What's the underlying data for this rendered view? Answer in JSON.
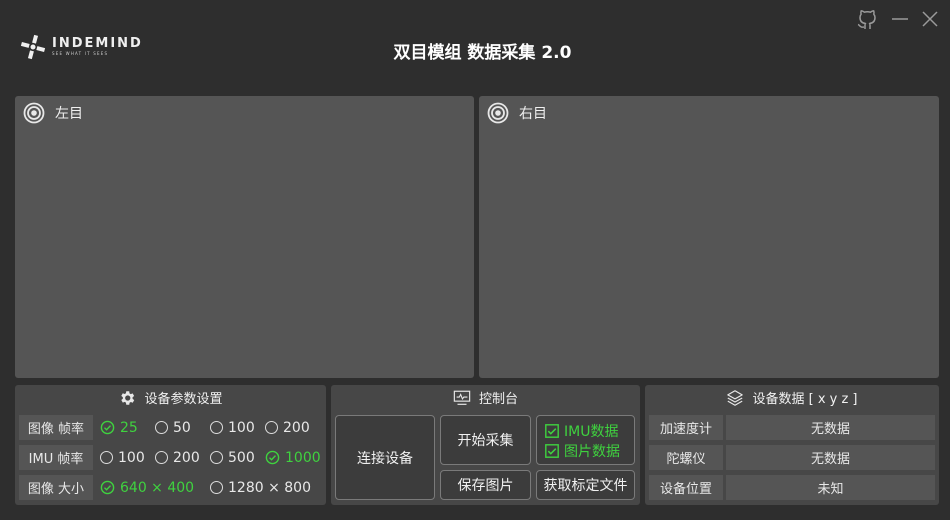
{
  "header": {
    "logo_name": "INDEMIND",
    "logo_tagline": "SEE WHAT IT SEES",
    "title": "双目模组 数据采集 2.0"
  },
  "window_controls": [
    "github-icon",
    "minimize-icon",
    "close-icon"
  ],
  "views": {
    "left": {
      "label": "左目",
      "icon": "camera-lens-icon"
    },
    "right": {
      "label": "右目",
      "icon": "camera-lens-icon"
    }
  },
  "settings_panel": {
    "title": "设备参数设置",
    "icon": "gear-icon",
    "rows": [
      {
        "label": "图像 帧率",
        "options": [
          "25",
          "50",
          "100",
          "200"
        ],
        "selected": "25"
      },
      {
        "label": "IMU 帧率",
        "options": [
          "100",
          "200",
          "500",
          "1000"
        ],
        "selected": "1000"
      },
      {
        "label": "图像 大小",
        "options": [
          "640 × 400",
          "1280 × 800"
        ],
        "selected": "640 × 400"
      }
    ]
  },
  "control_panel": {
    "title": "控制台",
    "icon": "monitor-pulse-icon",
    "connect": "连接设备",
    "start": "开始采集",
    "save_image": "保存图片",
    "get_calib": "获取标定文件",
    "imu_check": "IMU数据",
    "image_check": "图片数据"
  },
  "device_data_panel": {
    "title": "设备数据 [ x y z ]",
    "icon": "layers-icon",
    "rows": [
      {
        "label": "加速度计",
        "value": "无数据"
      },
      {
        "label": "陀螺仪",
        "value": "无数据"
      },
      {
        "label": "设备位置",
        "value": "未知"
      }
    ]
  },
  "colors": {
    "background": "#2e2e2e",
    "panel": "#474747",
    "view": "#555555",
    "accent_green": "#3fd23f"
  }
}
